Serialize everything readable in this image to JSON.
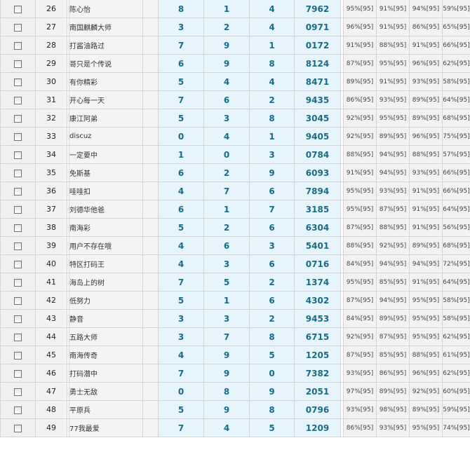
{
  "rows": [
    {
      "n": "26",
      "name": "陈心怡",
      "d": [
        "8",
        "1",
        "4"
      ],
      "code": "7962",
      "p": [
        "95%[95]",
        "91%[95]",
        "94%[95]",
        "59%[95]"
      ]
    },
    {
      "n": "27",
      "name": "南国麒麟大师",
      "d": [
        "3",
        "2",
        "4"
      ],
      "code": "0971",
      "p": [
        "96%[95]",
        "91%[95]",
        "86%[95]",
        "65%[95]"
      ]
    },
    {
      "n": "28",
      "name": "打酱油路过",
      "d": [
        "7",
        "9",
        "1"
      ],
      "code": "0172",
      "p": [
        "91%[95]",
        "88%[95]",
        "91%[95]",
        "66%[95]"
      ]
    },
    {
      "n": "29",
      "name": "哥只是个传说",
      "d": [
        "6",
        "9",
        "8"
      ],
      "code": "8124",
      "p": [
        "87%[95]",
        "95%[95]",
        "96%[95]",
        "62%[95]"
      ]
    },
    {
      "n": "30",
      "name": "有你精彩",
      "d": [
        "5",
        "4",
        "4"
      ],
      "code": "8471",
      "p": [
        "89%[95]",
        "91%[95]",
        "93%[95]",
        "58%[95]"
      ]
    },
    {
      "n": "31",
      "name": "开心每一天",
      "d": [
        "7",
        "6",
        "2"
      ],
      "code": "9435",
      "p": [
        "86%[95]",
        "93%[95]",
        "89%[95]",
        "64%[95]"
      ]
    },
    {
      "n": "32",
      "name": "康江阿弟",
      "d": [
        "5",
        "3",
        "8"
      ],
      "code": "3045",
      "p": [
        "92%[95]",
        "95%[95]",
        "89%[95]",
        "68%[95]"
      ]
    },
    {
      "n": "33",
      "name": "discuz",
      "d": [
        "0",
        "4",
        "1"
      ],
      "code": "9405",
      "p": [
        "92%[95]",
        "89%[95]",
        "96%[95]",
        "75%[95]"
      ]
    },
    {
      "n": "34",
      "name": "一定要中",
      "d": [
        "1",
        "0",
        "3"
      ],
      "code": "0784",
      "p": [
        "88%[95]",
        "94%[95]",
        "88%[95]",
        "57%[95]"
      ]
    },
    {
      "n": "35",
      "name": "免斯基",
      "d": [
        "6",
        "2",
        "9"
      ],
      "code": "6093",
      "p": [
        "91%[95]",
        "94%[95]",
        "93%[95]",
        "66%[95]"
      ]
    },
    {
      "n": "36",
      "name": "哇哇扣",
      "d": [
        "4",
        "7",
        "6"
      ],
      "code": "7894",
      "p": [
        "95%[95]",
        "93%[95]",
        "91%[95]",
        "66%[95]"
      ]
    },
    {
      "n": "37",
      "name": "刘德华他爸",
      "d": [
        "6",
        "1",
        "7"
      ],
      "code": "3185",
      "p": [
        "95%[95]",
        "87%[95]",
        "91%[95]",
        "64%[95]"
      ]
    },
    {
      "n": "38",
      "name": "南海彩",
      "d": [
        "5",
        "2",
        "6"
      ],
      "code": "6304",
      "p": [
        "87%[95]",
        "88%[95]",
        "91%[95]",
        "56%[95]"
      ]
    },
    {
      "n": "39",
      "name": "用户不存在哦",
      "d": [
        "4",
        "6",
        "3"
      ],
      "code": "5401",
      "p": [
        "88%[95]",
        "92%[95]",
        "89%[95]",
        "68%[95]"
      ]
    },
    {
      "n": "40",
      "name": "特区打码王",
      "d": [
        "4",
        "3",
        "6"
      ],
      "code": "0716",
      "p": [
        "84%[95]",
        "94%[95]",
        "94%[95]",
        "72%[95]"
      ]
    },
    {
      "n": "41",
      "name": "海岛上的树",
      "d": [
        "7",
        "5",
        "2"
      ],
      "code": "1374",
      "p": [
        "95%[95]",
        "85%[95]",
        "91%[95]",
        "64%[95]"
      ]
    },
    {
      "n": "42",
      "name": "低努力",
      "d": [
        "5",
        "1",
        "6"
      ],
      "code": "4302",
      "p": [
        "87%[95]",
        "94%[95]",
        "95%[95]",
        "58%[95]"
      ]
    },
    {
      "n": "43",
      "name": "静音",
      "d": [
        "3",
        "3",
        "2"
      ],
      "code": "9453",
      "p": [
        "84%[95]",
        "89%[95]",
        "95%[95]",
        "58%[95]"
      ]
    },
    {
      "n": "44",
      "name": "五路大师",
      "d": [
        "3",
        "7",
        "8"
      ],
      "code": "6715",
      "p": [
        "92%[95]",
        "87%[95]",
        "95%[95]",
        "62%[95]"
      ]
    },
    {
      "n": "45",
      "name": "南海传奇",
      "d": [
        "4",
        "9",
        "5"
      ],
      "code": "1205",
      "p": [
        "87%[95]",
        "85%[95]",
        "88%[95]",
        "61%[95]"
      ]
    },
    {
      "n": "46",
      "name": "打码潜中",
      "d": [
        "7",
        "9",
        "0"
      ],
      "code": "7382",
      "p": [
        "93%[95]",
        "86%[95]",
        "96%[95]",
        "62%[95]"
      ]
    },
    {
      "n": "47",
      "name": "勇士无敌",
      "d": [
        "0",
        "8",
        "9"
      ],
      "code": "2051",
      "p": [
        "97%[95]",
        "89%[95]",
        "92%[95]",
        "60%[95]"
      ]
    },
    {
      "n": "48",
      "name": "平原兵",
      "d": [
        "5",
        "9",
        "8"
      ],
      "code": "0796",
      "p": [
        "93%[95]",
        "98%[95]",
        "89%[95]",
        "59%[95]"
      ]
    },
    {
      "n": "49",
      "name": "77我最爱",
      "d": [
        "7",
        "4",
        "5"
      ],
      "code": "1209",
      "p": [
        "86%[95]",
        "93%[95]",
        "95%[95]",
        "74%[95]"
      ]
    }
  ]
}
